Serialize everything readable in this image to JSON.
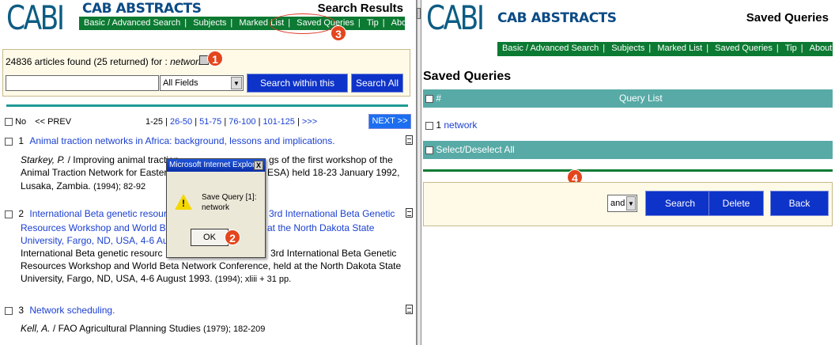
{
  "left": {
    "logo": "CABI",
    "brand": "CAB ABSTRACTS",
    "title": "Search Results",
    "nav": [
      "Basic / Advanced Search",
      "Subjects",
      "Marked List",
      "Saved Queries",
      "Tip",
      "About"
    ],
    "summary_prefix": "24836 articles found (25 returned) for : ",
    "summary_query": "network",
    "search_value": "",
    "field_select": "All Fields",
    "search_within_label": "Search within this Result",
    "search_all_label": "Search All",
    "no_label": "No",
    "prev_label": "<< PREV",
    "pages": [
      "1-25",
      "26-50",
      "51-75",
      "76-100",
      "101-125",
      ">>>"
    ],
    "next_label": "NEXT >>",
    "results": [
      {
        "num": "1",
        "title": "Animal traction networks in Africa: background, lessons and implications.",
        "author": "Starkey, P.",
        "source_a": "Improving animal traction",
        "source_b": "gs of the first workshop of the",
        "source_c": "Animal Traction Network for Easter",
        "source_d": "ESA) held 18-23 January 1992,",
        "source_e": "Lusaka, Zambia.",
        "meta": "(1994); 82-92"
      },
      {
        "num": "2",
        "title_a": "International Beta genetic resourc",
        "title_b": "3rd International Beta Genetic",
        "title_c": "Resources Workshop and World Be",
        "title_d": "d at the North Dakota State",
        "title_e": "University, Fargo, ND, USA, 4-6 Au",
        "src_a": "International Beta genetic resourc",
        "src_b": "3rd International Beta Genetic",
        "src_c": "Resources Workshop and World Beta Network Conference, held at the North Dakota State",
        "src_d": "University, Fargo, ND, USA, 4-6 August 1993.",
        "meta": "(1994); xliii + 31 pp."
      },
      {
        "num": "3",
        "title": "Network scheduling.",
        "author": "Kell, A.",
        "source": "FAO Agricultural Planning Studies",
        "meta": "(1979); 182-209"
      }
    ],
    "dialog": {
      "title": "Microsoft Internet Explorer",
      "close": "X",
      "message_1": "Save Query [1]:",
      "message_2": "network",
      "ok_label": "OK"
    }
  },
  "right": {
    "logo": "CABI",
    "brand": "CAB ABSTRACTS",
    "title": "Saved Queries",
    "nav": [
      "Basic / Advanced Search",
      "Subjects",
      "Marked List",
      "Saved Queries",
      "Tip",
      "About"
    ],
    "heading": "Saved Queries",
    "col_num": "#",
    "col_list": "Query List",
    "query_num": "1",
    "query_text": "network",
    "select_all": "Select/Deselect All",
    "op_select": "and",
    "search_label": "Search",
    "delete_label": "Delete",
    "back_label": "Back"
  },
  "badges": [
    "1",
    "2",
    "3",
    "4"
  ],
  "colors": {
    "nav_green": "#0c7a32",
    "teal_bar": "#57aaa6",
    "button_blue": "#0e33c9",
    "badge_red": "#e4451d",
    "info_bg": "#fffae8"
  }
}
